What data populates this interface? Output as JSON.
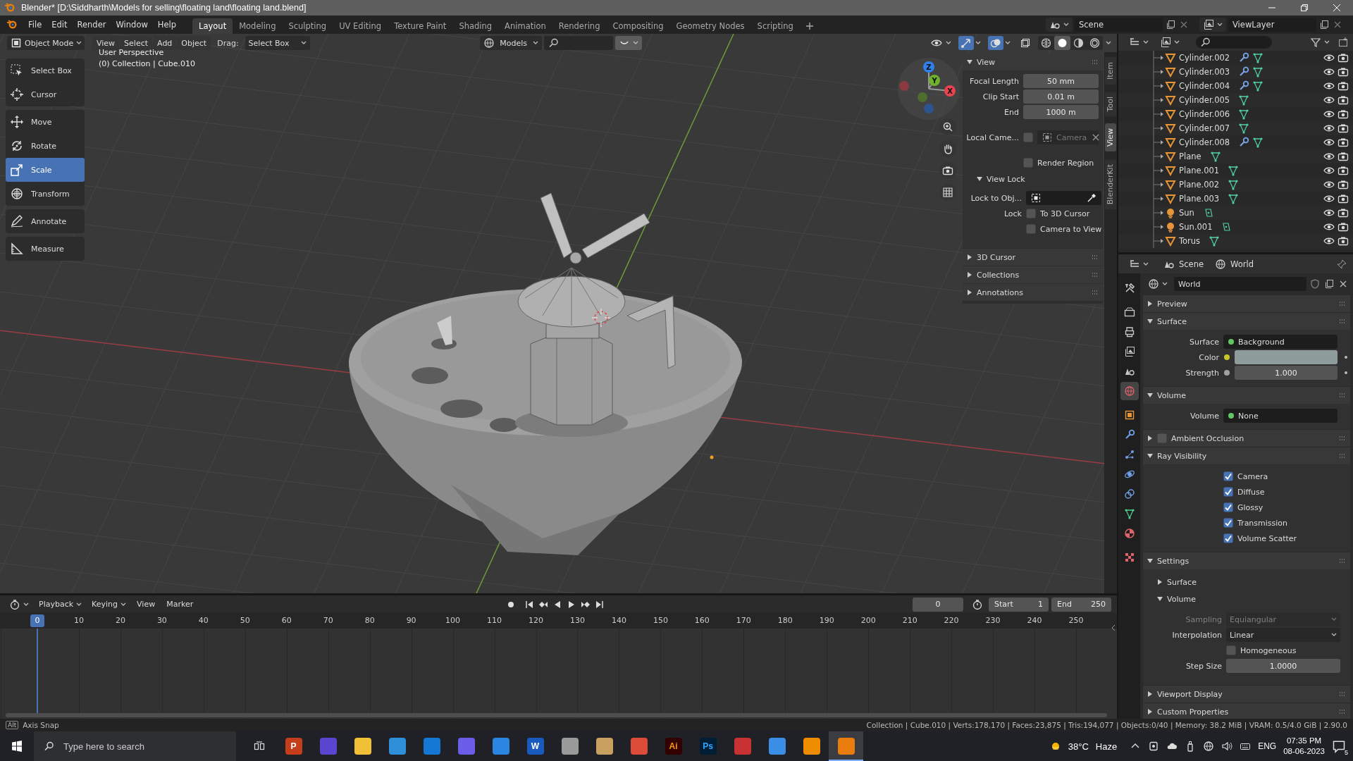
{
  "window": {
    "title": "Blender* [D:\\Siddharth\\Models for selling\\floating land\\floating land.blend]"
  },
  "menu": [
    "File",
    "Edit",
    "Render",
    "Window",
    "Help"
  ],
  "workspaces": [
    {
      "label": "Layout",
      "selected": true
    },
    {
      "label": "Modeling",
      "selected": false
    },
    {
      "label": "Sculpting",
      "selected": false
    },
    {
      "label": "UV Editing",
      "selected": false
    },
    {
      "label": "Texture Paint",
      "selected": false
    },
    {
      "label": "Shading",
      "selected": false
    },
    {
      "label": "Animation",
      "selected": false
    },
    {
      "label": "Rendering",
      "selected": false
    },
    {
      "label": "Compositing",
      "selected": false
    },
    {
      "label": "Geometry Nodes",
      "selected": false
    },
    {
      "label": "Scripting",
      "selected": false
    }
  ],
  "scene": {
    "value": "Scene"
  },
  "view_layer": {
    "value": "ViewLayer"
  },
  "viewport": {
    "mode": "Object Mode",
    "menus": [
      "View",
      "Select",
      "Add",
      "Object"
    ],
    "drag_label": "Drag:",
    "drag_value": "Select Box",
    "collection_filter": "Models",
    "filter_toggle": {
      "on": true
    },
    "toggles": [
      {
        "kind": "visibility",
        "on": false
      },
      {
        "kind": "gizmo",
        "on": true
      },
      {
        "kind": "overlay",
        "on": true
      },
      {
        "kind": "xray",
        "on": false
      }
    ],
    "shading": [
      {
        "kind": "wireframe",
        "selected": false
      },
      {
        "kind": "solid",
        "selected": true
      },
      {
        "kind": "material",
        "selected": false
      },
      {
        "kind": "rendered",
        "selected": false
      }
    ],
    "perspective": "User Perspective",
    "context": "(0) Collection | Cube.010",
    "tool_groups": [
      [
        {
          "label": "Select Box",
          "kind": "select",
          "selected": false
        },
        {
          "label": "Cursor",
          "kind": "cursor",
          "selected": false
        }
      ],
      [
        {
          "label": "Move",
          "kind": "move",
          "selected": false
        },
        {
          "label": "Rotate",
          "kind": "rotate",
          "selected": false
        },
        {
          "label": "Scale",
          "kind": "scale",
          "selected": true
        },
        {
          "label": "Transform",
          "kind": "transform",
          "selected": false
        }
      ],
      [
        {
          "label": "Annotate",
          "kind": "annotate",
          "selected": false
        }
      ],
      [
        {
          "label": "Measure",
          "kind": "measure",
          "selected": false
        }
      ]
    ],
    "gizmo_axes": [
      "X",
      "Y",
      "Z"
    ],
    "sidebar_tabs": [
      {
        "label": "Item",
        "selected": false
      },
      {
        "label": "Tool",
        "selected": false
      },
      {
        "label": "View",
        "selected": true
      },
      {
        "label": "BlenderKit",
        "selected": false
      }
    ],
    "sidebar_panels": [
      {
        "title": "View",
        "expanded": true,
        "rows": [
          {
            "kind": "number",
            "label": "Focal Length",
            "value": "50 mm"
          },
          {
            "kind": "number",
            "label": "Clip Start",
            "value": "0.01 m"
          },
          {
            "kind": "number",
            "label": "End",
            "value": "1000 m"
          },
          {
            "kind": "camera_field",
            "label": "Local Came...",
            "checked": false,
            "placeholder": "Camera"
          },
          {
            "kind": "checkbox",
            "text": "Render Region",
            "checked": false
          }
        ],
        "subpanels": [
          {
            "title": "View Lock",
            "expanded": true,
            "rows": [
              {
                "kind": "object_field",
                "label": "Lock to Obj..."
              },
              {
                "kind": "checkbox",
                "label": "Lock",
                "text": "To 3D Cursor",
                "checked": false
              },
              {
                "kind": "checkbox",
                "text": "Camera to View",
                "checked": false
              }
            ]
          }
        ]
      },
      {
        "title": "3D Cursor",
        "expanded": false
      },
      {
        "title": "Collections",
        "expanded": false
      },
      {
        "title": "Annotations",
        "expanded": false
      }
    ]
  },
  "outliner": {
    "items": [
      {
        "name": "Cylinder.002",
        "kind": "mesh",
        "modifier": true
      },
      {
        "name": "Cylinder.003",
        "kind": "mesh",
        "modifier": true
      },
      {
        "name": "Cylinder.004",
        "kind": "mesh",
        "modifier": true
      },
      {
        "name": "Cylinder.005",
        "kind": "mesh",
        "modifier": false
      },
      {
        "name": "Cylinder.006",
        "kind": "mesh",
        "modifier": false
      },
      {
        "name": "Cylinder.007",
        "kind": "mesh",
        "modifier": false
      },
      {
        "name": "Cylinder.008",
        "kind": "mesh",
        "modifier": true
      },
      {
        "name": "Plane",
        "kind": "mesh",
        "modifier": false
      },
      {
        "name": "Plane.001",
        "kind": "mesh",
        "modifier": false
      },
      {
        "name": "Plane.002",
        "kind": "mesh",
        "modifier": false
      },
      {
        "name": "Plane.003",
        "kind": "mesh",
        "modifier": false
      },
      {
        "name": "Sun",
        "kind": "light",
        "modifier": false
      },
      {
        "name": "Sun.001",
        "kind": "light",
        "modifier": false
      },
      {
        "name": "Torus",
        "kind": "mesh",
        "modifier": false
      }
    ]
  },
  "properties": {
    "breadcrumbs": [
      "Scene",
      "World"
    ],
    "tab_groups": [
      [
        {
          "kind": "tool",
          "selected": false
        }
      ],
      [
        {
          "kind": "render",
          "selected": false
        },
        {
          "kind": "output",
          "selected": false
        },
        {
          "kind": "view_layer",
          "selected": false
        },
        {
          "kind": "scene",
          "selected": false
        },
        {
          "kind": "world",
          "selected": true
        }
      ],
      [
        {
          "kind": "object",
          "selected": false
        },
        {
          "kind": "modifiers",
          "selected": false
        },
        {
          "kind": "particles",
          "selected": false
        },
        {
          "kind": "physics",
          "selected": false
        },
        {
          "kind": "constraints",
          "selected": false
        },
        {
          "kind": "data",
          "selected": false
        },
        {
          "kind": "material",
          "selected": false
        }
      ],
      [
        {
          "kind": "texture",
          "selected": false
        }
      ]
    ],
    "world": "World",
    "panels": [
      {
        "title": "Preview",
        "expanded": false
      },
      {
        "title": "Surface",
        "expanded": true,
        "rows": [
          {
            "kind": "socket",
            "label": "Surface",
            "value": "Background",
            "socket": {
              "color": "#63c763"
            }
          },
          {
            "kind": "color",
            "label": "Color",
            "socket": {
              "color": "#c7c729"
            },
            "color": "#8e9c9c",
            "decorator": true
          },
          {
            "kind": "number",
            "label": "Strength",
            "value": "1.000",
            "socket": {
              "color": "#a1a1a1"
            },
            "decorator": true
          }
        ]
      },
      {
        "title": "Volume",
        "expanded": true,
        "rows": [
          {
            "kind": "socket",
            "label": "Volume",
            "value": "None",
            "socket": {
              "color": "#63c763"
            }
          }
        ]
      },
      {
        "title": "Ambient Occlusion",
        "expanded": false,
        "checkbox": false
      },
      {
        "title": "Ray Visibility",
        "expanded": true,
        "rows": [
          {
            "kind": "checkbox",
            "text": "Camera",
            "checked": true
          },
          {
            "kind": "checkbox",
            "text": "Diffuse",
            "checked": true
          },
          {
            "kind": "checkbox",
            "text": "Glossy",
            "checked": true
          },
          {
            "kind": "checkbox",
            "text": "Transmission",
            "checked": true
          },
          {
            "kind": "checkbox",
            "text": "Volume Scatter",
            "checked": true
          }
        ]
      },
      {
        "title": "Settings",
        "expanded": true,
        "subpanels": [
          {
            "title": "Surface",
            "expanded": false
          },
          {
            "title": "Volume",
            "expanded": true,
            "rows": [
              {
                "kind": "enum",
                "label": "Sampling",
                "value": "Equiangular",
                "disabled": true
              },
              {
                "kind": "enum",
                "label": "Interpolation",
                "value": "Linear",
                "disabled": false
              },
              {
                "kind": "checkbox",
                "text": "Homogeneous",
                "checked": false
              },
              {
                "kind": "number",
                "label": "Step Size",
                "value": "1.0000"
              }
            ]
          }
        ]
      },
      {
        "title": "Viewport Display",
        "expanded": false
      },
      {
        "title": "Custom Properties",
        "expanded": false
      }
    ]
  },
  "timeline": {
    "menus": [
      {
        "label": "Playback",
        "kind": "dropdown"
      },
      {
        "label": "Keying",
        "kind": "dropdown"
      },
      {
        "label": "View",
        "kind": "menu"
      },
      {
        "label": "Marker",
        "kind": "menu"
      }
    ],
    "current_frame": "0",
    "start": {
      "label": "Start",
      "value": "1"
    },
    "end": {
      "label": "End",
      "value": "250"
    },
    "ruler": [
      "10",
      "20",
      "30",
      "40",
      "50",
      "60",
      "70",
      "80",
      "90",
      "100",
      "110",
      "120",
      "130",
      "140",
      "150",
      "160",
      "170",
      "180",
      "190",
      "200",
      "210",
      "220",
      "230",
      "240",
      "250"
    ],
    "playhead": {
      "label": "0",
      "level": 0
    }
  },
  "status_bar": {
    "key": "Alt",
    "hint": "Axis Snap",
    "stats": "Collection | Cube.010 | Verts:178,170 | Faces:23,875 | Tris:194,077 | Objects:0/40 | Memory: 38.2 MiB | VRAM: 0.5/4.0 GiB | 2.90.0"
  },
  "taskbar": {
    "search_placeholder": "Type here to search",
    "apps": [
      {
        "color": "#c43e1c",
        "label": {
          "text": "P",
          "color": "#ffffff"
        },
        "active": false
      },
      {
        "color": "#5a45d0",
        "active": false
      },
      {
        "color": "#f2c036",
        "active": false
      },
      {
        "color": "#2f8fd8",
        "active": false
      },
      {
        "color": "#1478d4",
        "active": false
      },
      {
        "color": "#6a5ee8",
        "active": false
      },
      {
        "color": "#2a86e0",
        "active": false
      },
      {
        "color": "#185abd",
        "label": {
          "text": "W",
          "color": "#ffffff"
        },
        "active": false
      },
      {
        "color": "#9a9a9a",
        "active": false
      },
      {
        "color": "#c8a060",
        "active": false
      },
      {
        "color": "#dd4b39",
        "active": false
      },
      {
        "color": "#330000",
        "label": {
          "text": "Ai",
          "color": "#ff9a00"
        },
        "active": false
      },
      {
        "color": "#001e36",
        "label": {
          "text": "Ps",
          "color": "#31a8ff"
        },
        "active": false
      },
      {
        "color": "#c83232",
        "active": false
      },
      {
        "color": "#3a8ee6",
        "active": false
      },
      {
        "color": "#f08c00",
        "active": false
      },
      {
        "color": "#e87d0d",
        "active": true
      }
    ],
    "weather": {
      "temperature": "38°C",
      "condition": "Haze"
    },
    "language": "ENG",
    "time": "07:35 PM",
    "date": "08-06-2023",
    "notifications": "5"
  }
}
